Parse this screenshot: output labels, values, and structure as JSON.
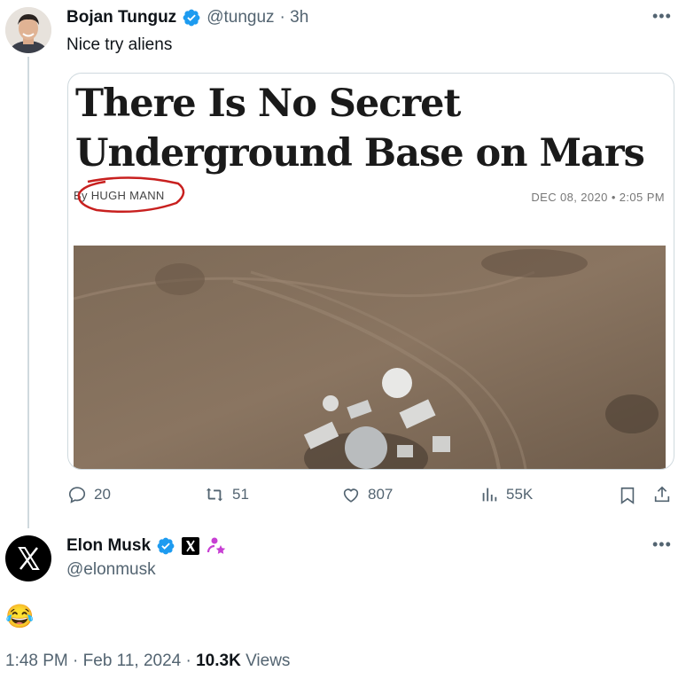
{
  "tweet": {
    "author_name": "Bojan Tunguz",
    "author_handle": "@tunguz",
    "time": "· 3h",
    "text": "Nice try aliens",
    "article": {
      "headline_line1": "There Is No Secret",
      "headline_line2": "Underground Base on Mars",
      "byline_prefix": "By",
      "byline_author": "HUGH MANN",
      "date": "DEC 08, 2020 • 2:05 PM"
    },
    "stats": {
      "replies": "20",
      "retweets": "51",
      "likes": "807",
      "views": "55K"
    }
  },
  "reply": {
    "author_name": "Elon Musk",
    "author_handle": "@elonmusk",
    "text": "😂",
    "timestamp": "1:48 PM · Feb 11, 2024 · ",
    "views_count": "10.3K",
    "views_label": "Views"
  },
  "colors": {
    "verified": "#1d9bf0",
    "muted": "#536471",
    "circle_annotation": "#c8201f"
  }
}
